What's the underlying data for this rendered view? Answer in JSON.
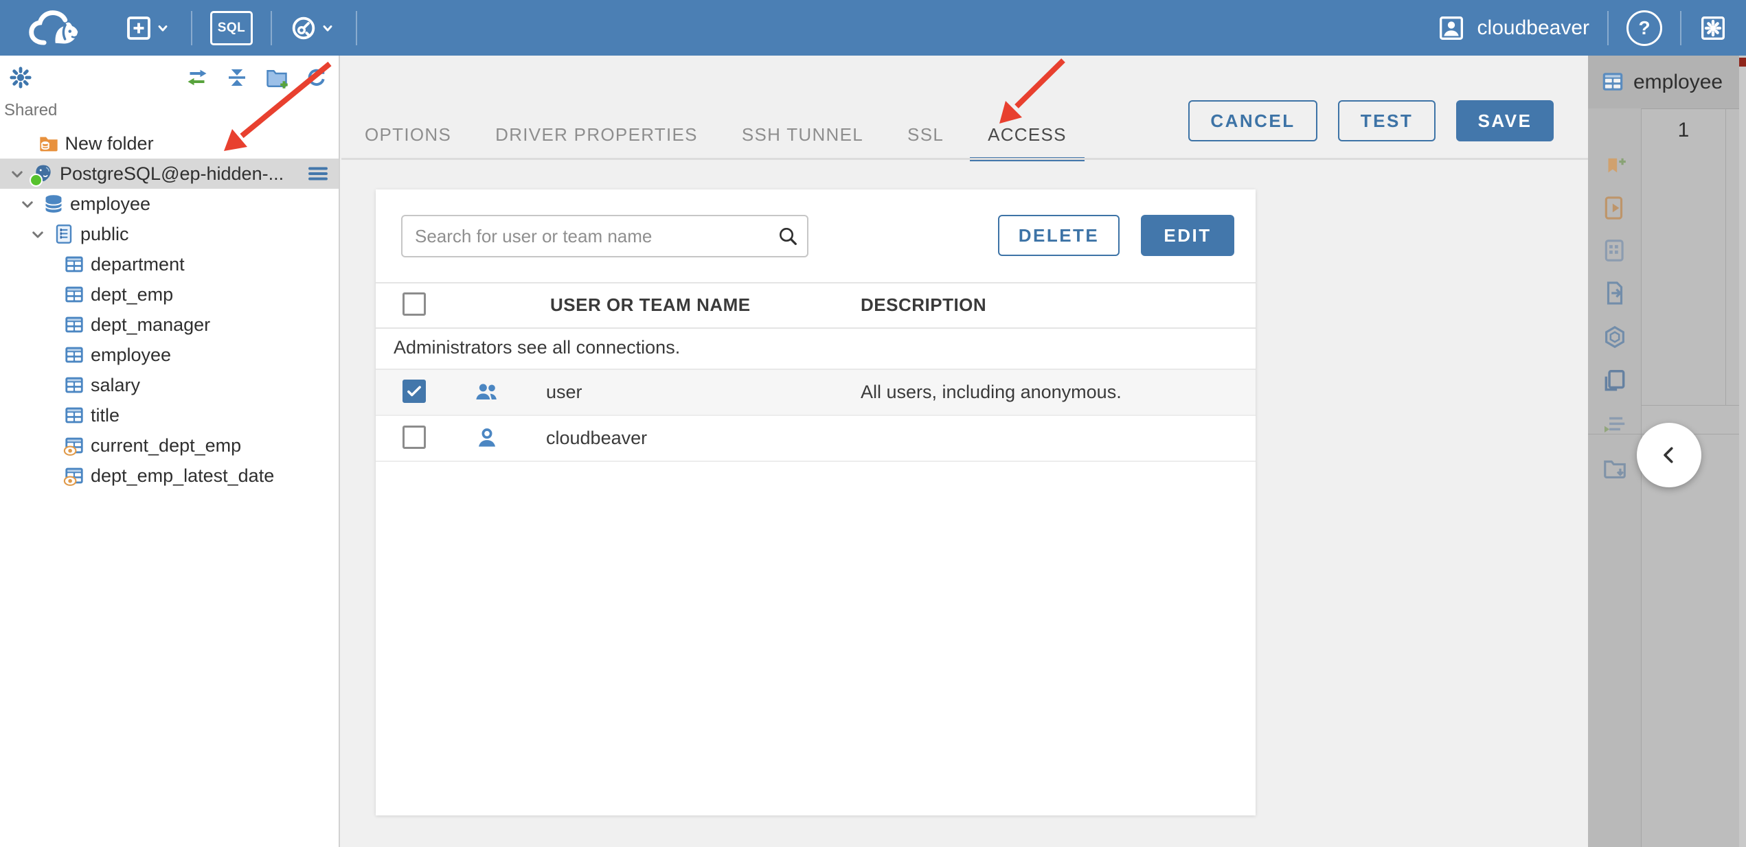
{
  "colors": {
    "topbar": "#4b7fb4",
    "accent": "#4377ab",
    "accent_border": "#3d73a6",
    "selection": "#d8d8d8",
    "arrow_red": "#e8402f",
    "dim_bg": "#bdbdbd"
  },
  "topbar": {
    "sql_label": "SQL",
    "user_label": "cloudbeaver",
    "help_glyph": "?"
  },
  "sidebar": {
    "section_label": "Shared",
    "tree": [
      {
        "label": "New folder",
        "icon": "folderdb",
        "level": 0.5
      },
      {
        "label": "PostgreSQL@ep-hidden-...",
        "icon": "postgres",
        "level": 0,
        "expandable": true,
        "selected": true,
        "menu": true,
        "status": true
      },
      {
        "label": "employee",
        "icon": "database",
        "level": 1,
        "expandable": true
      },
      {
        "label": "public",
        "icon": "schema",
        "level": 2,
        "expandable": true
      },
      {
        "label": "department",
        "icon": "table",
        "level": 3
      },
      {
        "label": "dept_emp",
        "icon": "table",
        "level": 3
      },
      {
        "label": "dept_manager",
        "icon": "table",
        "level": 3
      },
      {
        "label": "employee",
        "icon": "table",
        "level": 3
      },
      {
        "label": "salary",
        "icon": "table",
        "level": 3
      },
      {
        "label": "title",
        "icon": "table",
        "level": 3
      },
      {
        "label": "current_dept_emp",
        "icon": "view",
        "level": 3
      },
      {
        "label": "dept_emp_latest_date",
        "icon": "view",
        "level": 3
      }
    ]
  },
  "dialog": {
    "tabs": [
      {
        "label": "OPTIONS",
        "active": false
      },
      {
        "label": "DRIVER PROPERTIES",
        "active": false
      },
      {
        "label": "SSH TUNNEL",
        "active": false
      },
      {
        "label": "SSL",
        "active": false
      },
      {
        "label": "ACCESS",
        "active": true
      }
    ],
    "actions": {
      "cancel": "CANCEL",
      "test": "TEST",
      "save": "SAVE"
    },
    "access": {
      "search_placeholder": "Search for user or team name",
      "delete_label": "DELETE",
      "edit_label": "EDIT",
      "columns": [
        "USER OR TEAM NAME",
        "DESCRIPTION"
      ],
      "notice": "Administrators see all connections.",
      "rows": [
        {
          "name": "user",
          "description": "All users, including anonymous.",
          "checked": true,
          "icon": "team"
        },
        {
          "name": "cloudbeaver",
          "description": "",
          "checked": false,
          "icon": "person"
        }
      ]
    }
  },
  "right_panel": {
    "tab_label": "employee",
    "row_number": "1",
    "toolbar_icons": [
      "bookmark-add-icon",
      "script-run-icon",
      "table-script-icon",
      "export-doc-icon",
      "openai-icon",
      "copy-page-icon",
      "console-icon",
      "folder-import-icon"
    ]
  }
}
